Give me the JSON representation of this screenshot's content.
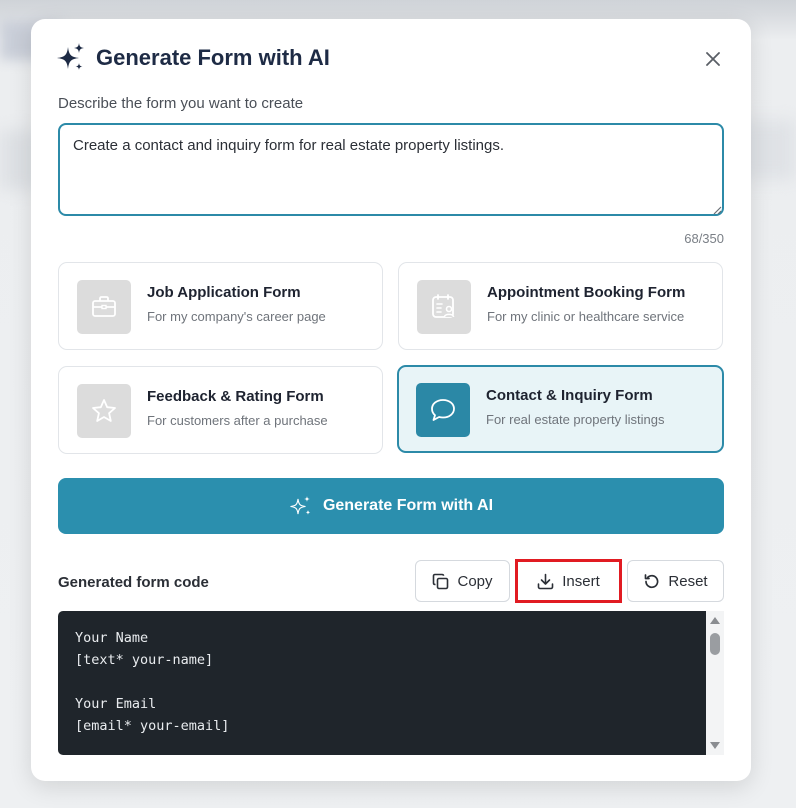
{
  "dialog": {
    "title": "Generate Form with AI",
    "close_label": "×"
  },
  "prompt": {
    "label": "Describe the form you want to create",
    "value": "Create a contact and inquiry form for real estate property listings.",
    "char_count": "68/350"
  },
  "templates": [
    {
      "title": "Job Application Form",
      "subtitle": "For my company's career page",
      "icon": "briefcase-icon",
      "selected": false
    },
    {
      "title": "Appointment Booking Form",
      "subtitle": "For my clinic or healthcare service",
      "icon": "calendar-user-icon",
      "selected": false
    },
    {
      "title": "Feedback & Rating Form",
      "subtitle": "For customers after a purchase",
      "icon": "star-icon",
      "selected": false
    },
    {
      "title": "Contact & Inquiry Form",
      "subtitle": "For real estate property listings",
      "icon": "chat-bubble-icon",
      "selected": true
    }
  ],
  "generate_button": {
    "label": "Generate Form with AI"
  },
  "output": {
    "label": "Generated form code",
    "copy_label": "Copy",
    "insert_label": "Insert",
    "reset_label": "Reset",
    "code": "Your Name\n[text* your-name]\n\nYour Email\n[email* your-email]"
  },
  "colors": {
    "accent": "#2b8fae",
    "title": "#1e2b45",
    "highlight_box": "#e11b22",
    "code_bg": "#1f252b"
  }
}
